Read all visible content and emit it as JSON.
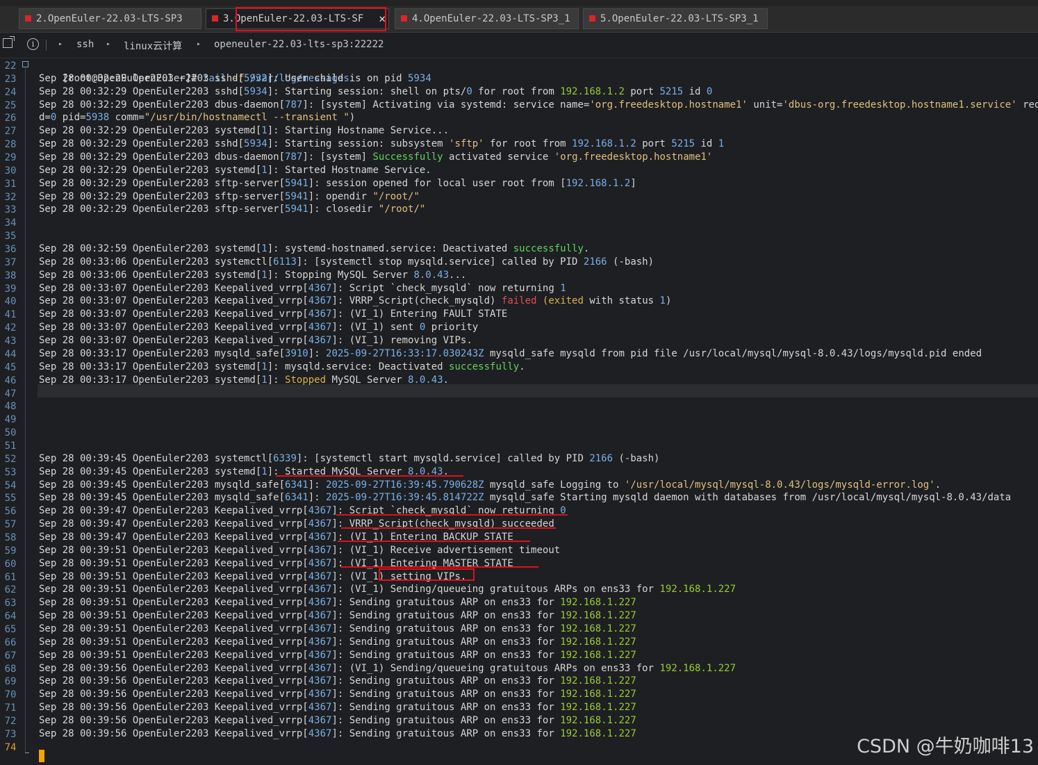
{
  "tabs": [
    {
      "label": "2.OpenEuler-22.03-LTS-SP3"
    },
    {
      "label": "3.OpenEuler-22.03-LTS-SF"
    },
    {
      "label": "4.OpenEuler-22.03-LTS-SP3_1"
    },
    {
      "label": "5.OpenEuler-22.03-LTS-SP3_1"
    }
  ],
  "breadcrumb": [
    "ssh",
    "linux云计算",
    "openeuler-22.03-lts-sp3:22222"
  ],
  "info_glyph": "i",
  "close_glyph": "✕",
  "prompt_user": "[root@OpenEuler2203 ~]#",
  "command": "tail",
  "command_flag": "-f",
  "command_arg": "/var/log/messages",
  "line_numbers": [
    "22",
    "23",
    "24",
    "25",
    "26",
    "27",
    "28",
    "29",
    "30",
    "31",
    "32",
    "33",
    "34",
    "35",
    "36",
    "37",
    "38",
    "39",
    "40",
    "41",
    "42",
    "43",
    "44",
    "45",
    "46",
    "47",
    "48",
    "49",
    "50",
    "51",
    "52",
    "53",
    "54",
    "55",
    "56",
    "57",
    "58",
    "59",
    "60",
    "61",
    "62",
    "63",
    "64",
    "65",
    "66",
    "67",
    "68",
    "69",
    "70",
    "71",
    "72",
    "73",
    "74"
  ],
  "log_lines": [
    [
      [
        "p",
        "Sep 28 00:32:29 OpenEuler2203 sshd["
      ],
      [
        "n",
        "5932"
      ],
      [
        "p",
        "]: User child is on pid "
      ],
      [
        "n",
        "5934"
      ]
    ],
    [
      [
        "p",
        "Sep 28 00:32:29 OpenEuler2203 sshd["
      ],
      [
        "n",
        "5934"
      ],
      [
        "p",
        "]: Starting session: shell on pts/"
      ],
      [
        "n",
        "0"
      ],
      [
        "p",
        " for root from "
      ],
      [
        "g",
        "192.168.1.2"
      ],
      [
        "p",
        " port "
      ],
      [
        "n",
        "5215"
      ],
      [
        "p",
        " id "
      ],
      [
        "n",
        "0"
      ]
    ],
    [
      [
        "p",
        "Sep 28 00:32:29 OpenEuler2203 dbus-daemon["
      ],
      [
        "n",
        "787"
      ],
      [
        "p",
        "]: [system] Activating via systemd: service name="
      ],
      [
        "s",
        "'org.freedesktop.hostname1'"
      ],
      [
        "p",
        " unit="
      ],
      [
        "s",
        "'dbus-org.freedesktop.hostname1.service'"
      ],
      [
        "p",
        " requeste"
      ]
    ],
    [
      [
        "p",
        "d="
      ],
      [
        "n",
        "0"
      ],
      [
        "p",
        " pid="
      ],
      [
        "n",
        "5938"
      ],
      [
        "p",
        " comm="
      ],
      [
        "s",
        "\"/usr/bin/hostnamectl --transient \""
      ],
      [
        "p",
        ")"
      ]
    ],
    [
      [
        "p",
        "Sep 28 00:32:29 OpenEuler2203 systemd["
      ],
      [
        "n",
        "1"
      ],
      [
        "p",
        "]: Starting Hostname Service..."
      ]
    ],
    [
      [
        "p",
        "Sep 28 00:32:29 OpenEuler2203 sshd["
      ],
      [
        "n",
        "5934"
      ],
      [
        "p",
        "]: Starting session: subsystem "
      ],
      [
        "s",
        "'sftp'"
      ],
      [
        "p",
        " for root from "
      ],
      [
        "n",
        "192.168.1.2"
      ],
      [
        "p",
        " port "
      ],
      [
        "n",
        "5215"
      ],
      [
        "p",
        " id "
      ],
      [
        "n",
        "1"
      ]
    ],
    [
      [
        "p",
        "Sep 28 00:32:29 OpenEuler2203 dbus-daemon["
      ],
      [
        "n",
        "787"
      ],
      [
        "p",
        "]: [system] "
      ],
      [
        "gr",
        "Successfully"
      ],
      [
        "p",
        " activated service "
      ],
      [
        "s",
        "'org.freedesktop.hostname1'"
      ]
    ],
    [
      [
        "p",
        "Sep 28 00:32:29 OpenEuler2203 systemd["
      ],
      [
        "n",
        "1"
      ],
      [
        "p",
        "]: Started Hostname Service."
      ]
    ],
    [
      [
        "p",
        "Sep 28 00:32:29 OpenEuler2203 sftp-server["
      ],
      [
        "n",
        "5941"
      ],
      [
        "p",
        "]: session opened for local user root from ["
      ],
      [
        "n",
        "192.168.1.2"
      ],
      [
        "p",
        "]"
      ]
    ],
    [
      [
        "p",
        "Sep 28 00:32:29 OpenEuler2203 sftp-server["
      ],
      [
        "n",
        "5941"
      ],
      [
        "p",
        "]: opendir "
      ],
      [
        "s",
        "\"/root/\""
      ]
    ],
    [
      [
        "p",
        "Sep 28 00:32:29 OpenEuler2203 sftp-server["
      ],
      [
        "n",
        "5941"
      ],
      [
        "p",
        "]: closedir "
      ],
      [
        "s",
        "\"/root/\""
      ]
    ],
    [],
    [],
    [
      [
        "p",
        "Sep 28 00:32:59 OpenEuler2203 systemd["
      ],
      [
        "n",
        "1"
      ],
      [
        "p",
        "]: systemd-hostnamed.service: Deactivated "
      ],
      [
        "gr",
        "successfully"
      ],
      [
        "p",
        "."
      ]
    ],
    [
      [
        "p",
        "Sep 28 00:33:06 OpenEuler2203 systemctl["
      ],
      [
        "n",
        "6113"
      ],
      [
        "p",
        "]: [systemctl stop mysqld.service] called by PID "
      ],
      [
        "n",
        "2166"
      ],
      [
        "p",
        " (-bash)"
      ]
    ],
    [
      [
        "p",
        "Sep 28 00:33:06 OpenEuler2203 systemd["
      ],
      [
        "n",
        "1"
      ],
      [
        "p",
        "]: Stopping MySQL Server "
      ],
      [
        "n",
        "8.0.43"
      ],
      [
        "p",
        "..."
      ]
    ],
    [
      [
        "p",
        "Sep 28 00:33:07 OpenEuler2203 Keepalived_vrrp["
      ],
      [
        "n",
        "4367"
      ],
      [
        "p",
        "]: Script `check_mysqld` now returning "
      ],
      [
        "n",
        "1"
      ]
    ],
    [
      [
        "p",
        "Sep 28 00:33:07 OpenEuler2203 Keepalived_vrrp["
      ],
      [
        "n",
        "4367"
      ],
      [
        "p",
        "]: VRRP_Script(check_mysqld) "
      ],
      [
        "r",
        "failed"
      ],
      [
        "p",
        " "
      ],
      [
        "y",
        "(exited"
      ],
      [
        "p",
        " with status "
      ],
      [
        "n",
        "1"
      ],
      [
        "p",
        ")"
      ]
    ],
    [
      [
        "p",
        "Sep 28 00:33:07 OpenEuler2203 Keepalived_vrrp["
      ],
      [
        "n",
        "4367"
      ],
      [
        "p",
        "]: (VI_1) Entering FAULT STATE"
      ]
    ],
    [
      [
        "p",
        "Sep 28 00:33:07 OpenEuler2203 Keepalived_vrrp["
      ],
      [
        "n",
        "4367"
      ],
      [
        "p",
        "]: (VI_1) sent "
      ],
      [
        "n",
        "0"
      ],
      [
        "p",
        " priority"
      ]
    ],
    [
      [
        "p",
        "Sep 28 00:33:07 OpenEuler2203 Keepalived_vrrp["
      ],
      [
        "n",
        "4367"
      ],
      [
        "p",
        "]: (VI_1) removing VIPs."
      ]
    ],
    [
      [
        "p",
        "Sep 28 00:33:17 OpenEuler2203 mysqld_safe["
      ],
      [
        "n",
        "3910"
      ],
      [
        "p",
        "]: "
      ],
      [
        "n",
        "2025-09-27T16:33:17.030243Z"
      ],
      [
        "p",
        " mysqld_safe mysqld from pid file /usr/local/mysql/mysql-8.0.43/logs/mysqld.pid ended"
      ]
    ],
    [
      [
        "p",
        "Sep 28 00:33:17 OpenEuler2203 systemd["
      ],
      [
        "n",
        "1"
      ],
      [
        "p",
        "]: mysqld.service: Deactivated "
      ],
      [
        "gr",
        "successfully"
      ],
      [
        "p",
        "."
      ]
    ],
    [
      [
        "p",
        "Sep 28 00:33:17 OpenEuler2203 systemd["
      ],
      [
        "n",
        "1"
      ],
      [
        "p",
        "]: "
      ],
      [
        "y",
        "Stopped"
      ],
      [
        "p",
        " MySQL Server "
      ],
      [
        "n",
        "8.0.43"
      ],
      [
        "p",
        "."
      ]
    ],
    [],
    [],
    [],
    [],
    [],
    [
      [
        "p",
        "Sep 28 00:39:45 OpenEuler2203 systemctl["
      ],
      [
        "n",
        "6339"
      ],
      [
        "p",
        "]: [systemctl start mysqld.service] called by PID "
      ],
      [
        "n",
        "2166"
      ],
      [
        "p",
        " (-bash)"
      ]
    ],
    [
      [
        "p",
        "Sep 28 00:39:45 OpenEuler2203 systemd["
      ],
      [
        "n",
        "1"
      ],
      [
        "p",
        "]: Started MySQL Server "
      ],
      [
        "n",
        "8.0.43"
      ],
      [
        "p",
        "."
      ]
    ],
    [
      [
        "p",
        "Sep 28 00:39:45 OpenEuler2203 mysqld_safe["
      ],
      [
        "n",
        "6341"
      ],
      [
        "p",
        "]: "
      ],
      [
        "n",
        "2025-09-27T16:39:45.790628Z"
      ],
      [
        "p",
        " mysqld_safe Logging to "
      ],
      [
        "s",
        "'/usr/local/mysql/mysql-8.0.43/logs/mysqld-error.log'"
      ],
      [
        "p",
        "."
      ]
    ],
    [
      [
        "p",
        "Sep 28 00:39:45 OpenEuler2203 mysqld_safe["
      ],
      [
        "n",
        "6341"
      ],
      [
        "p",
        "]: "
      ],
      [
        "n",
        "2025-09-27T16:39:45.814722Z"
      ],
      [
        "p",
        " mysqld_safe Starting mysqld daemon with databases from /usr/local/mysql/mysql-8.0.43/data"
      ]
    ],
    [
      [
        "p",
        "Sep 28 00:39:47 OpenEuler2203 Keepalived_vrrp["
      ],
      [
        "n",
        "4367"
      ],
      [
        "p",
        "]: Script `check_mysqld` now returning "
      ],
      [
        "n",
        "0"
      ]
    ],
    [
      [
        "p",
        "Sep 28 00:39:47 OpenEuler2203 Keepalived_vrrp["
      ],
      [
        "n",
        "4367"
      ],
      [
        "p",
        "]: VRRP_Script(check_mysqld) succeeded"
      ]
    ],
    [
      [
        "p",
        "Sep 28 00:39:47 OpenEuler2203 Keepalived_vrrp["
      ],
      [
        "n",
        "4367"
      ],
      [
        "p",
        "]: (VI_1) Entering BACKUP STATE"
      ]
    ],
    [
      [
        "p",
        "Sep 28 00:39:51 OpenEuler2203 Keepalived_vrrp["
      ],
      [
        "n",
        "4367"
      ],
      [
        "p",
        "]: (VI_1) Receive advertisement timeout"
      ]
    ],
    [
      [
        "p",
        "Sep 28 00:39:51 OpenEuler2203 Keepalived_vrrp["
      ],
      [
        "n",
        "4367"
      ],
      [
        "p",
        "]: (VI_1) Entering MASTER STATE"
      ]
    ],
    [
      [
        "p",
        "Sep 28 00:39:51 OpenEuler2203 Keepalived_vrrp["
      ],
      [
        "n",
        "4367"
      ],
      [
        "p",
        "]: (VI_1) setting VIPs."
      ]
    ],
    [
      [
        "p",
        "Sep 28 00:39:51 OpenEuler2203 Keepalived_vrrp["
      ],
      [
        "n",
        "4367"
      ],
      [
        "p",
        "]: (VI_1) Sending/queueing gratuitous ARPs on ens33 for "
      ],
      [
        "g",
        "192.168.1.227"
      ]
    ],
    [
      [
        "p",
        "Sep 28 00:39:51 OpenEuler2203 Keepalived_vrrp["
      ],
      [
        "n",
        "4367"
      ],
      [
        "p",
        "]: Sending gratuitous ARP on ens33 for "
      ],
      [
        "g",
        "192.168.1.227"
      ]
    ],
    [
      [
        "p",
        "Sep 28 00:39:51 OpenEuler2203 Keepalived_vrrp["
      ],
      [
        "n",
        "4367"
      ],
      [
        "p",
        "]: Sending gratuitous ARP on ens33 for "
      ],
      [
        "g",
        "192.168.1.227"
      ]
    ],
    [
      [
        "p",
        "Sep 28 00:39:51 OpenEuler2203 Keepalived_vrrp["
      ],
      [
        "n",
        "4367"
      ],
      [
        "p",
        "]: Sending gratuitous ARP on ens33 for "
      ],
      [
        "g",
        "192.168.1.227"
      ]
    ],
    [
      [
        "p",
        "Sep 28 00:39:51 OpenEuler2203 Keepalived_vrrp["
      ],
      [
        "n",
        "4367"
      ],
      [
        "p",
        "]: Sending gratuitous ARP on ens33 for "
      ],
      [
        "g",
        "192.168.1.227"
      ]
    ],
    [
      [
        "p",
        "Sep 28 00:39:51 OpenEuler2203 Keepalived_vrrp["
      ],
      [
        "n",
        "4367"
      ],
      [
        "p",
        "]: Sending gratuitous ARP on ens33 for "
      ],
      [
        "g",
        "192.168.1.227"
      ]
    ],
    [
      [
        "p",
        "Sep 28 00:39:56 OpenEuler2203 Keepalived_vrrp["
      ],
      [
        "n",
        "4367"
      ],
      [
        "p",
        "]: (VI_1) Sending/queueing gratuitous ARPs on ens33 for "
      ],
      [
        "g",
        "192.168.1.227"
      ]
    ],
    [
      [
        "p",
        "Sep 28 00:39:56 OpenEuler2203 Keepalived_vrrp["
      ],
      [
        "n",
        "4367"
      ],
      [
        "p",
        "]: Sending gratuitous ARP on ens33 for "
      ],
      [
        "g",
        "192.168.1.227"
      ]
    ],
    [
      [
        "p",
        "Sep 28 00:39:56 OpenEuler2203 Keepalived_vrrp["
      ],
      [
        "n",
        "4367"
      ],
      [
        "p",
        "]: Sending gratuitous ARP on ens33 for "
      ],
      [
        "g",
        "192.168.1.227"
      ]
    ],
    [
      [
        "p",
        "Sep 28 00:39:56 OpenEuler2203 Keepalived_vrrp["
      ],
      [
        "n",
        "4367"
      ],
      [
        "p",
        "]: Sending gratuitous ARP on ens33 for "
      ],
      [
        "g",
        "192.168.1.227"
      ]
    ],
    [
      [
        "p",
        "Sep 28 00:39:56 OpenEuler2203 Keepalived_vrrp["
      ],
      [
        "n",
        "4367"
      ],
      [
        "p",
        "]: Sending gratuitous ARP on ens33 for "
      ],
      [
        "g",
        "192.168.1.227"
      ]
    ],
    [
      [
        "p",
        "Sep 28 00:39:56 OpenEuler2203 Keepalived_vrrp["
      ],
      [
        "n",
        "4367"
      ],
      [
        "p",
        "]: Sending gratuitous ARP on ens33 for "
      ],
      [
        "g",
        "192.168.1.227"
      ]
    ],
    [],
    []
  ],
  "watermark": "CSDN @牛奶咖啡13",
  "colors": {
    "accent_tab": "#d9262a",
    "highlight": "#e0101a",
    "number": "#7ab0e8",
    "ip": "#9acd32",
    "success": "#5fd35f",
    "failed": "#e05050"
  }
}
